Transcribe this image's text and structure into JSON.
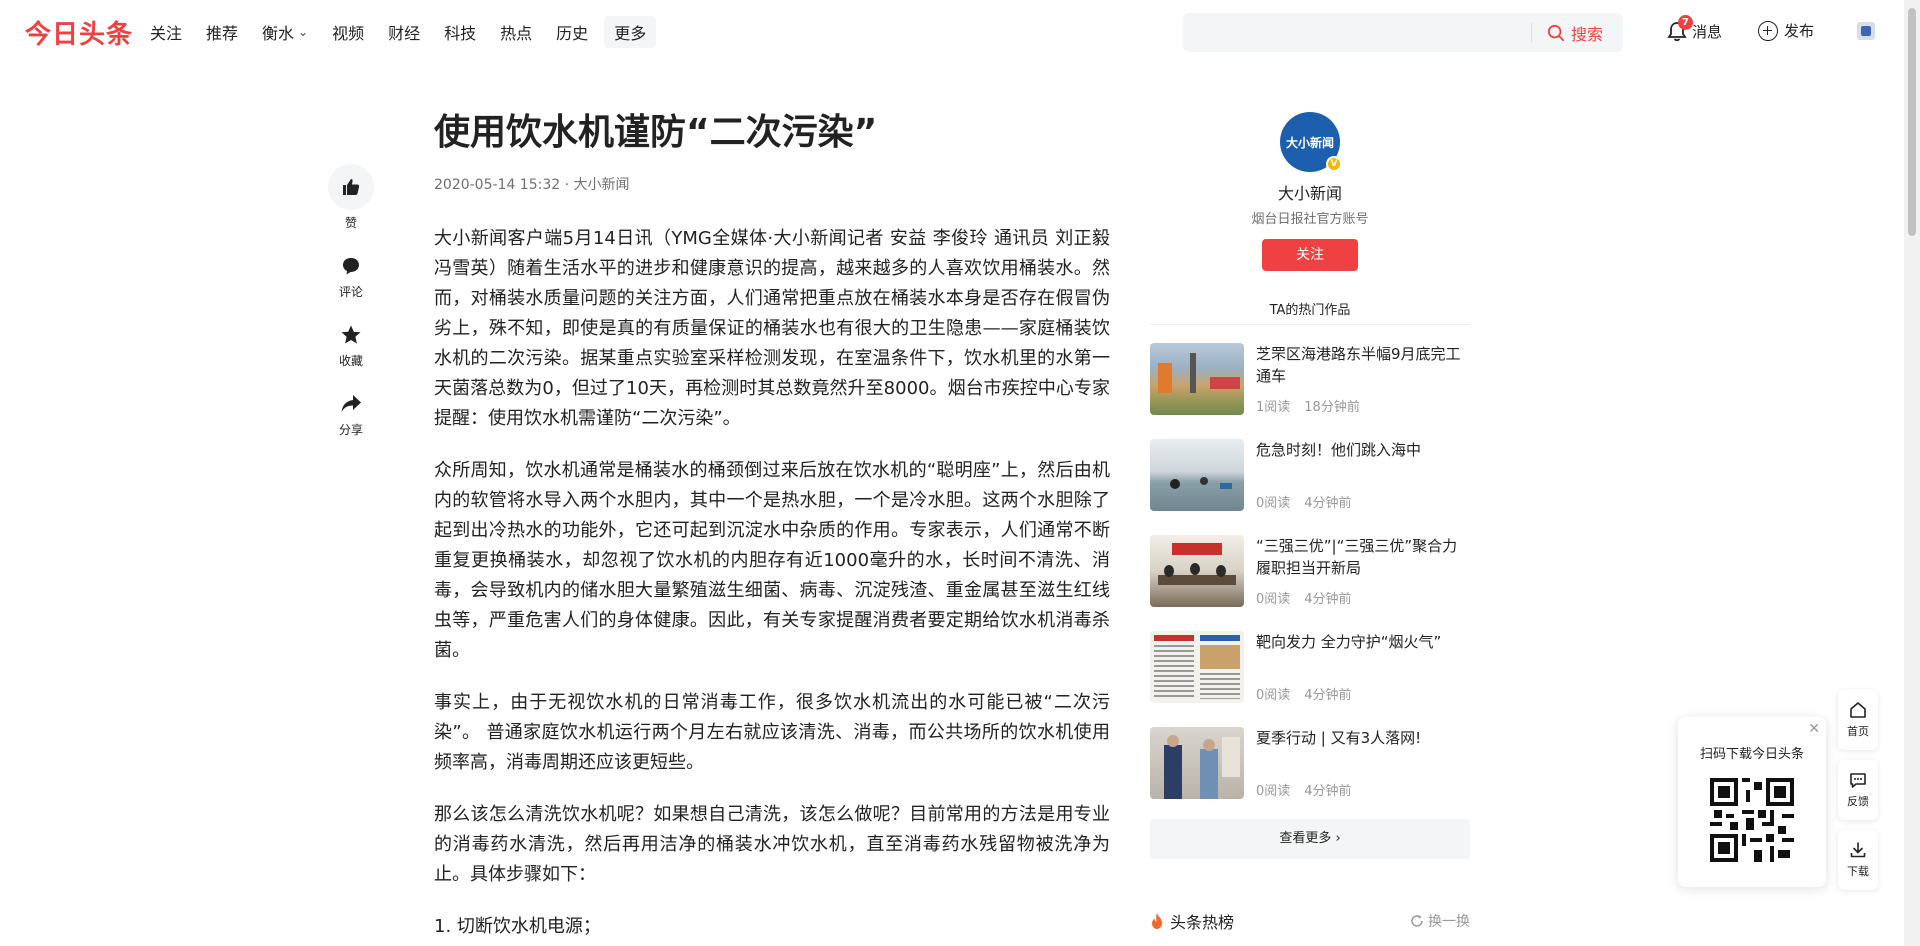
{
  "header": {
    "logo": "今日头条",
    "nav": [
      {
        "label": "关注"
      },
      {
        "label": "推荐"
      },
      {
        "label": "衡水",
        "dropdown": true
      },
      {
        "label": "视频"
      },
      {
        "label": "财经"
      },
      {
        "label": "科技"
      },
      {
        "label": "热点"
      },
      {
        "label": "历史"
      },
      {
        "label": "更多"
      }
    ],
    "search": {
      "placeholder": "",
      "button_label": "搜索"
    },
    "messages": {
      "label": "消息",
      "badge": "7"
    },
    "publish_label": "发布",
    "accent_color": "#f04142"
  },
  "actions": [
    {
      "icon": "thumbs-up-icon",
      "label": "赞"
    },
    {
      "icon": "comment-icon",
      "label": "评论"
    },
    {
      "icon": "star-icon",
      "label": "收藏"
    },
    {
      "icon": "share-icon",
      "label": "分享"
    }
  ],
  "article": {
    "title": "使用饮水机谨防“二次污染”",
    "meta": "2020-05-14 15:32 · 大小新闻",
    "paragraphs": [
      "大小新闻客户端5月14日讯（YMG全媒体·大小新闻记者 安益 李俊玲 通讯员 刘正毅 冯雪英）随着生活水平的进步和健康意识的提高，越来越多的人喜欢饮用桶装水。然而，对桶装水质量问题的关注方面，人们通常把重点放在桶装水本身是否存在假冒伪劣上，殊不知，即使是真的有质量保证的桶装水也有很大的卫生隐患——家庭桶装饮水机的二次污染。据某重点实验室采样检测发现，在室温条件下，饮水机里的水第一天菌落总数为0，但过了10天，再检测时其总数竟然升至8000。烟台市疾控中心专家提醒：使用饮水机需谨防“二次污染”。",
      "众所周知，饮水机通常是桶装水的桶颈倒过来后放在饮水机的“聪明座”上，然后由机内的软管将水导入两个水胆内，其中一个是热水胆，一个是冷水胆。这两个水胆除了起到出冷热水的功能外，它还可起到沉淀水中杂质的作用。专家表示，人们通常不断重复更换桶装水，却忽视了饮水机的内胆存有近1000毫升的水，长时间不清洗、消毒，会导致机内的储水胆大量繁殖滋生细菌、病毒、沉淀残渣、重金属甚至滋生红线虫等，严重危害人们的身体健康。因此，有关专家提醒消费者要定期给饮水机消毒杀菌。",
      "事实上，由于无视饮水机的日常消毒工作，很多饮水机流出的水可能已被“二次污染”。 普通家庭饮水机运行两个月左右就应该清洗、消毒，而公共场所的饮水机使用频率高，消毒周期还应该更短些。",
      "那么该怎么清洗饮水机呢？如果想自己清洗，该怎么做呢？目前常用的方法是用专业的消毒药水清洗，然后再用洁净的桶装水冲饮水机，直至消毒药水残留物被洗净为止。具体步骤如下：",
      "1. 切断饮水机电源；"
    ]
  },
  "author": {
    "avatar_text": "大小新闻",
    "name": "大小新闻",
    "desc": "烟台日报社官方账号",
    "follow_label": "关注"
  },
  "hot_works": {
    "title": "TA的热门作品",
    "items": [
      {
        "title": "芝罘区海港路东半幅9月底完工通车",
        "reads": "1阅读",
        "time": "18分钟前"
      },
      {
        "title": "危急时刻！他们跳入海中",
        "reads": "0阅读",
        "time": "4分钟前"
      },
      {
        "title": "“三强三优”|“三强三优”聚合力 履职担当开新局",
        "reads": "0阅读",
        "time": "4分钟前"
      },
      {
        "title": "靶向发力 全力守护“烟火气”",
        "reads": "0阅读",
        "time": "4分钟前"
      },
      {
        "title": "夏季行动 | 又有3人落网!",
        "reads": "0阅读",
        "time": "4分钟前"
      }
    ],
    "more_label": "查看更多"
  },
  "hot_list": {
    "title": "头条热榜",
    "refresh_label": "换一换"
  },
  "qr": {
    "text": "扫码下载今日头条"
  },
  "side_tools": [
    {
      "icon": "home-icon",
      "label": "首页"
    },
    {
      "icon": "feedback-icon",
      "label": "反馈"
    },
    {
      "icon": "download-icon",
      "label": "下载"
    }
  ]
}
